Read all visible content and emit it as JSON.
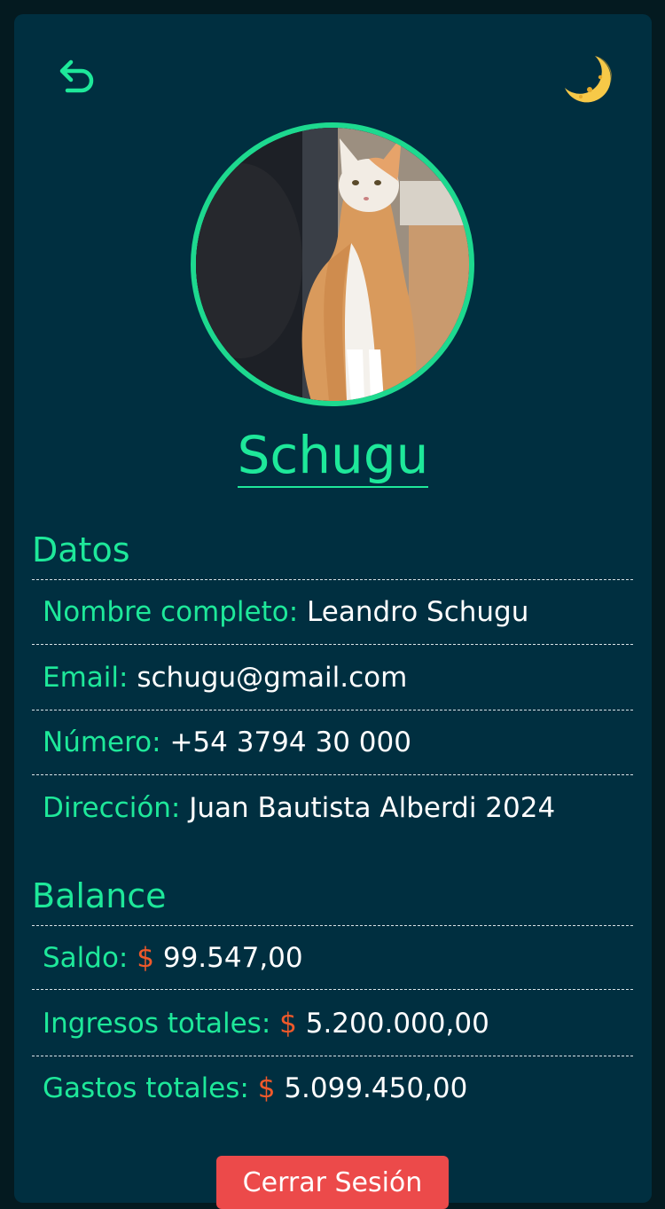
{
  "header": {
    "back_icon": "undo-arrow-icon",
    "theme_icon": "crescent-moon-icon"
  },
  "profile": {
    "avatar": "cat-photo",
    "username": "Schugu"
  },
  "datos": {
    "title": "Datos",
    "rows": [
      {
        "label": "Nombre completo:",
        "value": "Leandro Schugu"
      },
      {
        "label": "Email:",
        "value": "schugu@gmail.com"
      },
      {
        "label": "Número:",
        "value": "+54 3794 30 000"
      },
      {
        "label": "Dirección:",
        "value": "Juan Bautista Alberdi 2024"
      }
    ]
  },
  "balance": {
    "title": "Balance",
    "currency": "$",
    "rows": [
      {
        "label": "Saldo:",
        "value": "99.547,00"
      },
      {
        "label": "Ingresos totales:",
        "value": "5.200.000,00"
      },
      {
        "label": "Gastos totales:",
        "value": "5.099.450,00"
      }
    ]
  },
  "actions": {
    "logout_label": "Cerrar Sesión"
  },
  "colors": {
    "background": "#041a20",
    "card": "#002f40",
    "accent": "#1ee89a",
    "currency": "#f0592a",
    "logout": "#ec4a4a",
    "moon": "#f7c948"
  }
}
